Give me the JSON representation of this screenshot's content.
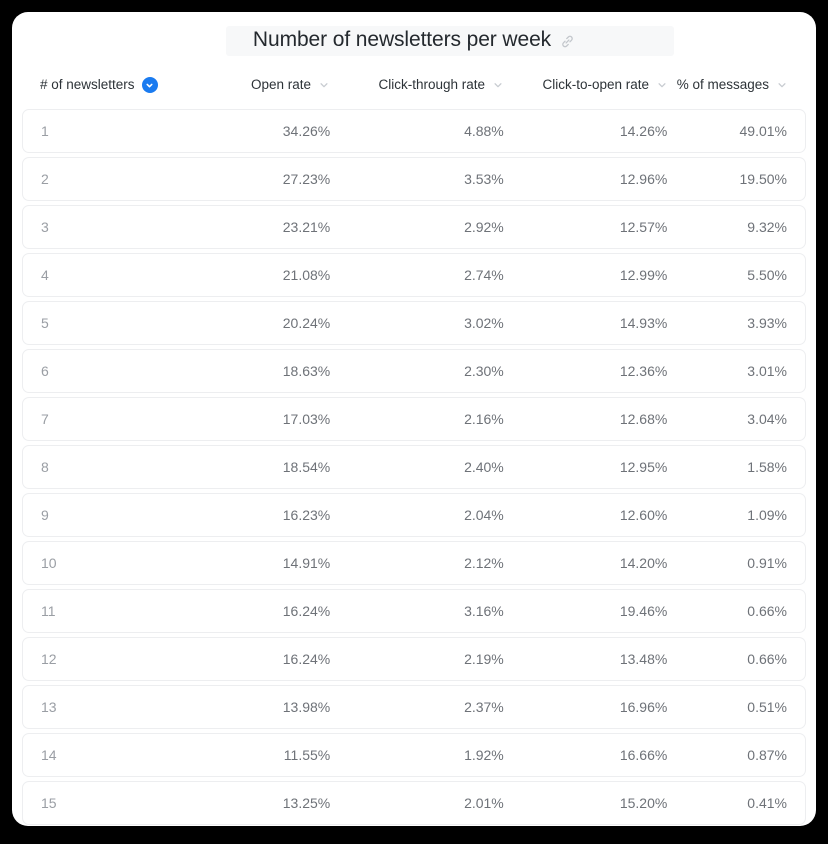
{
  "header": {
    "title": "Number of newsletters per week",
    "link_icon": "link-icon"
  },
  "table": {
    "columns": [
      {
        "label": "# of newsletters",
        "sort_state": "active-desc",
        "align": "left"
      },
      {
        "label": "Open rate",
        "sort_state": "inactive",
        "align": "right"
      },
      {
        "label": "Click-through rate",
        "sort_state": "inactive",
        "align": "right"
      },
      {
        "label": "Click-to-open rate",
        "sort_state": "inactive",
        "align": "right"
      },
      {
        "label": "% of messages",
        "sort_state": "inactive",
        "align": "right"
      }
    ],
    "rows": [
      {
        "newsletters": "1",
        "open_rate": "34.26%",
        "click_through_rate": "4.88%",
        "click_to_open_rate": "14.26%",
        "pct_messages": "49.01%"
      },
      {
        "newsletters": "2",
        "open_rate": "27.23%",
        "click_through_rate": "3.53%",
        "click_to_open_rate": "12.96%",
        "pct_messages": "19.50%"
      },
      {
        "newsletters": "3",
        "open_rate": "23.21%",
        "click_through_rate": "2.92%",
        "click_to_open_rate": "12.57%",
        "pct_messages": "9.32%"
      },
      {
        "newsletters": "4",
        "open_rate": "21.08%",
        "click_through_rate": "2.74%",
        "click_to_open_rate": "12.99%",
        "pct_messages": "5.50%"
      },
      {
        "newsletters": "5",
        "open_rate": "20.24%",
        "click_through_rate": "3.02%",
        "click_to_open_rate": "14.93%",
        "pct_messages": "3.93%"
      },
      {
        "newsletters": "6",
        "open_rate": "18.63%",
        "click_through_rate": "2.30%",
        "click_to_open_rate": "12.36%",
        "pct_messages": "3.01%"
      },
      {
        "newsletters": "7",
        "open_rate": "17.03%",
        "click_through_rate": "2.16%",
        "click_to_open_rate": "12.68%",
        "pct_messages": "3.04%"
      },
      {
        "newsletters": "8",
        "open_rate": "18.54%",
        "click_through_rate": "2.40%",
        "click_to_open_rate": "12.95%",
        "pct_messages": "1.58%"
      },
      {
        "newsletters": "9",
        "open_rate": "16.23%",
        "click_through_rate": "2.04%",
        "click_to_open_rate": "12.60%",
        "pct_messages": "1.09%"
      },
      {
        "newsletters": "10",
        "open_rate": "14.91%",
        "click_through_rate": "2.12%",
        "click_to_open_rate": "14.20%",
        "pct_messages": "0.91%"
      },
      {
        "newsletters": "11",
        "open_rate": "16.24%",
        "click_through_rate": "3.16%",
        "click_to_open_rate": "19.46%",
        "pct_messages": "0.66%"
      },
      {
        "newsletters": "12",
        "open_rate": "16.24%",
        "click_through_rate": "2.19%",
        "click_to_open_rate": "13.48%",
        "pct_messages": "0.66%"
      },
      {
        "newsletters": "13",
        "open_rate": "13.98%",
        "click_through_rate": "2.37%",
        "click_to_open_rate": "16.96%",
        "pct_messages": "0.51%"
      },
      {
        "newsletters": "14",
        "open_rate": "11.55%",
        "click_through_rate": "1.92%",
        "click_to_open_rate": "16.66%",
        "pct_messages": "0.87%"
      },
      {
        "newsletters": "15",
        "open_rate": "13.25%",
        "click_through_rate": "2.01%",
        "click_to_open_rate": "15.20%",
        "pct_messages": "0.41%"
      }
    ]
  },
  "colors": {
    "accent_blue": "#1a7bf0",
    "page_background": "#000000",
    "card_background": "#ffffff",
    "row_border": "#edeef0",
    "header_text": "#2d3338",
    "value_text": "#6e7278"
  },
  "chart_data": {
    "type": "table",
    "title": "Number of newsletters per week",
    "columns": [
      "# of newsletters",
      "Open rate",
      "Click-through rate",
      "Click-to-open rate",
      "% of messages"
    ],
    "x": [
      1,
      2,
      3,
      4,
      5,
      6,
      7,
      8,
      9,
      10,
      11,
      12,
      13,
      14,
      15
    ],
    "xlabel": "# of newsletters",
    "ylabel": "",
    "series": [
      {
        "name": "Open rate",
        "unit": "%",
        "values": [
          34.26,
          27.23,
          23.21,
          21.08,
          20.24,
          18.63,
          17.03,
          18.54,
          16.23,
          14.91,
          16.24,
          16.24,
          13.98,
          11.55,
          13.25
        ]
      },
      {
        "name": "Click-through rate",
        "unit": "%",
        "values": [
          4.88,
          3.53,
          2.92,
          2.74,
          3.02,
          2.3,
          2.16,
          2.4,
          2.04,
          2.12,
          3.16,
          2.19,
          2.37,
          1.92,
          2.01
        ]
      },
      {
        "name": "Click-to-open rate",
        "unit": "%",
        "values": [
          14.26,
          12.96,
          12.57,
          12.99,
          14.93,
          12.36,
          12.68,
          12.95,
          12.6,
          14.2,
          19.46,
          13.48,
          16.96,
          16.66,
          15.2
        ]
      },
      {
        "name": "% of messages",
        "unit": "%",
        "values": [
          49.01,
          19.5,
          9.32,
          5.5,
          3.93,
          3.01,
          3.04,
          1.58,
          1.09,
          0.91,
          0.66,
          0.66,
          0.51,
          0.87,
          0.41
        ]
      }
    ],
    "sorted_by": "# of newsletters",
    "sort_direction": "ascending",
    "grid": false,
    "legend": "none"
  }
}
